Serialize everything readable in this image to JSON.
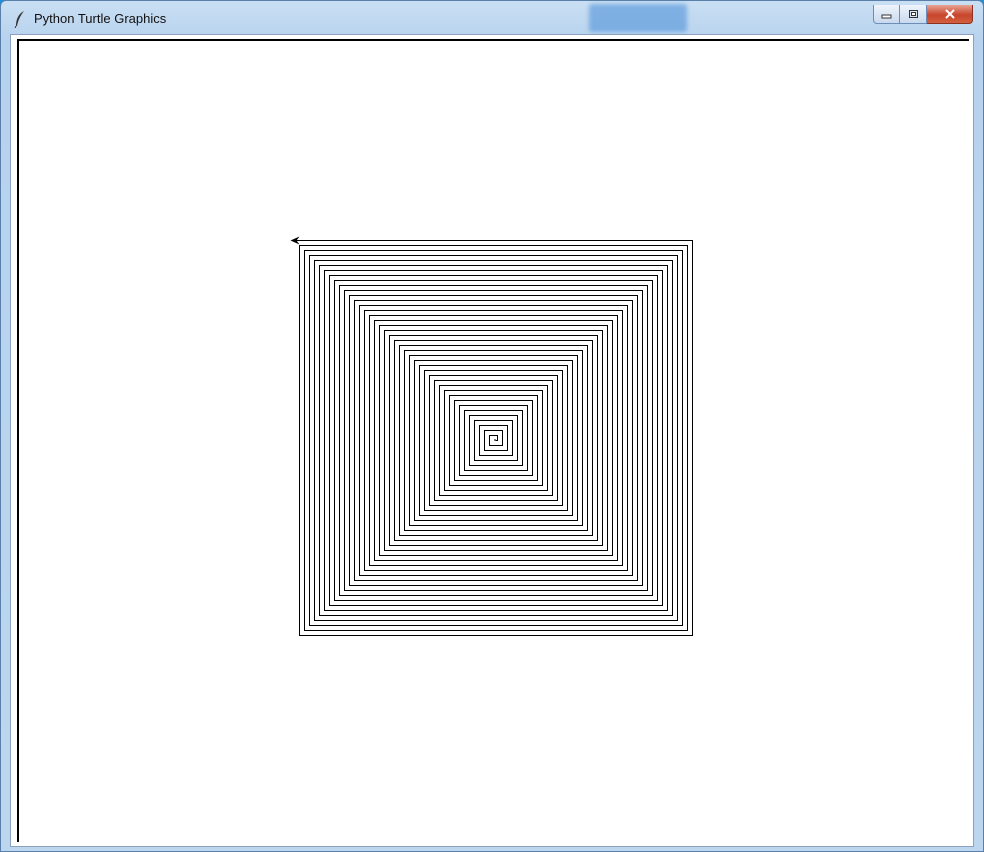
{
  "window": {
    "title": "Python Turtle Graphics",
    "app_icon": "feather-icon",
    "controls": {
      "minimize_icon": "minimize-icon",
      "maximize_icon": "maximize-icon",
      "close_icon": "close-icon"
    }
  },
  "canvas": {
    "background": "#ffffff",
    "drawing": {
      "shape": "square-spiral",
      "stroke_color": "#000000",
      "step_increment": 5,
      "turn_angle_degrees": 90,
      "segment_count": 159,
      "turtle_cursor": "arrow-cursor-icon"
    }
  },
  "colors": {
    "titlebar": "#bcd6ef",
    "close_button": "#c7452c",
    "desktop": "#1e8fdc"
  }
}
